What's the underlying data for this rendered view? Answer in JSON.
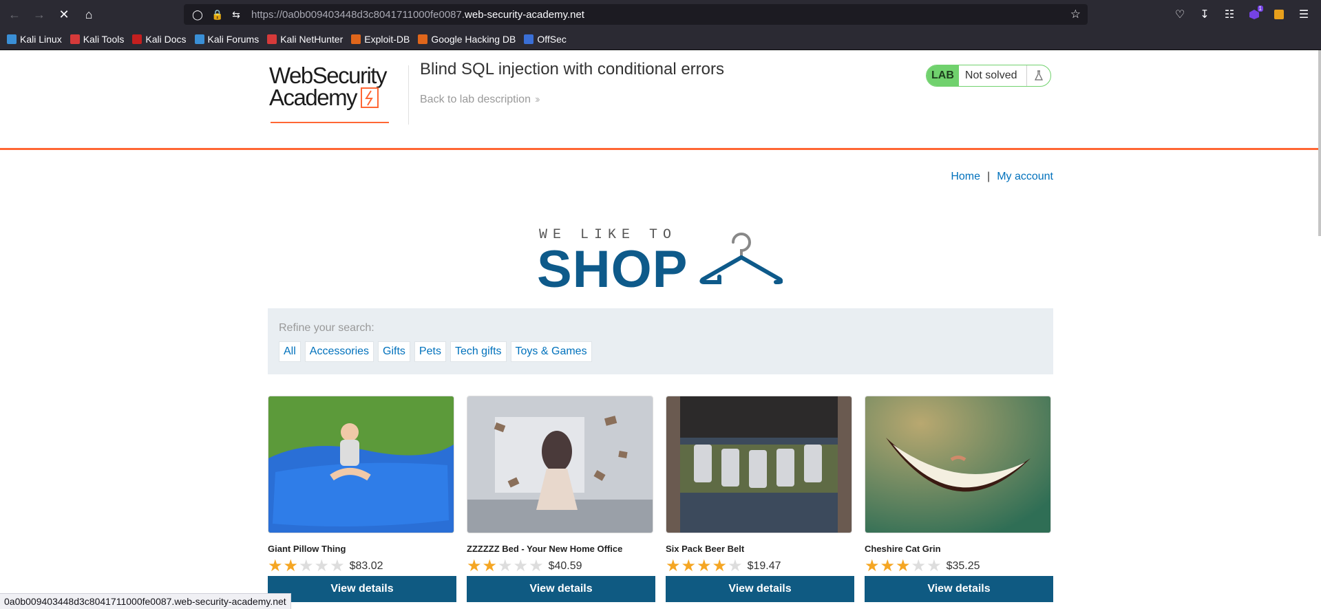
{
  "browser": {
    "url_prefix": "https://0a0b009403448d3c8041711000fe0087.",
    "url_domain": "web-security-academy.net",
    "extension_badge": "1",
    "bookmarks": [
      {
        "label": "Kali Linux",
        "color": "#3a8fd6"
      },
      {
        "label": "Kali Tools",
        "color": "#d63a3a"
      },
      {
        "label": "Kali Docs",
        "color": "#c41f1f"
      },
      {
        "label": "Kali Forums",
        "color": "#3a8fd6"
      },
      {
        "label": "Kali NetHunter",
        "color": "#d63a3a"
      },
      {
        "label": "Exploit-DB",
        "color": "#e0661b"
      },
      {
        "label": "Google Hacking DB",
        "color": "#e0661b"
      },
      {
        "label": "OffSec",
        "color": "#3a6fd6"
      }
    ],
    "status_url": "0a0b009403448d3c8041711000fe0087.web-security-academy.net"
  },
  "lab": {
    "logo_line1": "WebSecurity",
    "logo_line2": "Academy",
    "title": "Blind SQL injection with conditional errors",
    "back_link": "Back to lab description",
    "tag": "LAB",
    "status": "Not solved"
  },
  "nav": {
    "home": "Home",
    "separator": "|",
    "account": "My account"
  },
  "shop": {
    "tagline": "WE LIKE TO",
    "word": "SHOP",
    "brand_color": "#0e5a8a"
  },
  "filters": {
    "label": "Refine your search:",
    "items": [
      "All",
      "Accessories",
      "Gifts",
      "Pets",
      "Tech gifts",
      "Toys & Games"
    ]
  },
  "products": [
    {
      "name": "Giant Pillow Thing",
      "rating": 2,
      "price": "$83.02",
      "button": "View details"
    },
    {
      "name": "ZZZZZZ Bed - Your New Home Office",
      "rating": 2,
      "price": "$40.59",
      "button": "View details"
    },
    {
      "name": "Six Pack Beer Belt",
      "rating": 4,
      "price": "$19.47",
      "button": "View details"
    },
    {
      "name": "Cheshire Cat Grin",
      "rating": 3,
      "price": "$35.25",
      "button": "View details"
    }
  ]
}
